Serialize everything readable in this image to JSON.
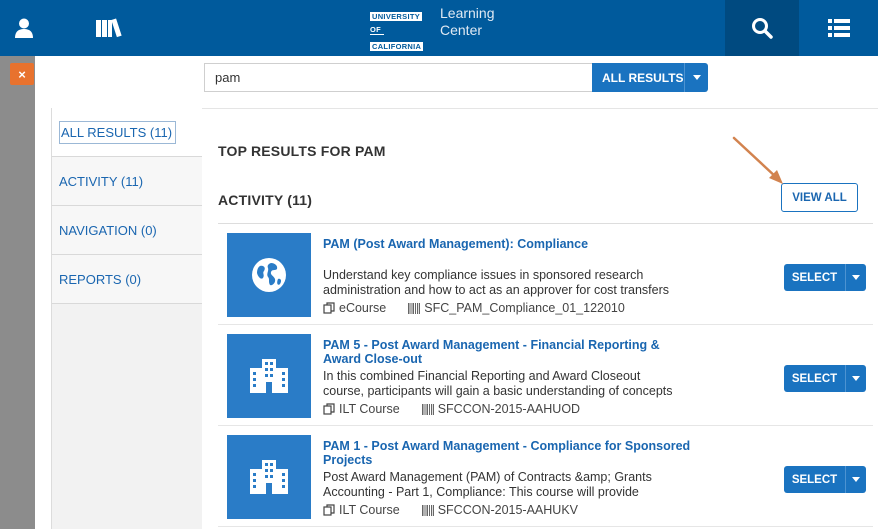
{
  "header": {
    "logo_line1": "UNIVERSITY",
    "logo_line2": "OF",
    "logo_line3": "CALIFORNIA",
    "center_line1": "Learning",
    "center_line2": "Center",
    "icons": [
      "user-icon",
      "library-icon",
      "search-icon",
      "list-menu-icon"
    ]
  },
  "close_label": "×",
  "search": {
    "value": "pam",
    "scope_label": "ALL RESULTS"
  },
  "sidebar": {
    "items": [
      {
        "label": "ALL RESULTS (11)",
        "active": true
      },
      {
        "label": "ACTIVITY (11)"
      },
      {
        "label": "NAVIGATION (0)"
      },
      {
        "label": "REPORTS (0)"
      }
    ]
  },
  "main": {
    "top_heading": "TOP RESULTS FOR PAM",
    "activity_heading": "ACTIVITY (11)",
    "view_all_label": "VIEW ALL",
    "results": [
      {
        "title": "PAM (Post Award Management): Compliance",
        "description": "Understand key compliance issues in sponsored research administration and how to act as an approver for cost transfers",
        "type": "eCourse",
        "code": "SFC_PAM_Compliance_01_122010",
        "icon": "globe-icon",
        "select_label": "SELECT"
      },
      {
        "title": "PAM 5 - Post Award Management - Financial Reporting & Award Close-out",
        "description": "In this combined Financial Reporting and Award Closeout course, participants will gain a basic understanding of concepts and",
        "type": "ILT Course",
        "code": "SFCCON-2015-AAHUOD",
        "icon": "building-icon",
        "select_label": "SELECT"
      },
      {
        "title": "PAM 1 - Post Award Management - Compliance for Sponsored Projects",
        "description": "Post Award Management (PAM) of Contracts &amp; Grants Accounting - Part 1, Compliance:  This course will provide",
        "type": "ILT Course",
        "code": "SFCCON-2015-AAHUKV",
        "icon": "building-icon",
        "select_label": "SELECT"
      }
    ]
  },
  "colors": {
    "header": "#005a9c",
    "accent": "#1a73c0",
    "close": "#e8722e",
    "arrow": "#d2834f"
  }
}
